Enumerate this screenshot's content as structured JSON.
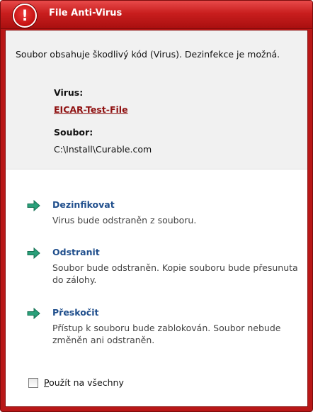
{
  "window": {
    "title": "File Anti-Virus",
    "icon": "alert-exclamation-icon"
  },
  "info": {
    "message": "Soubor obsahuje škodlivý kód (Virus). Dezinfekce je možná.",
    "virus_label": "Virus:",
    "virus_name": "EICAR-Test-File",
    "file_label": "Soubor:",
    "file_path": "C:\\Install\\Curable.com"
  },
  "actions": [
    {
      "title": "Dezinfikovat",
      "description": "Virus bude odstraněn z souboru."
    },
    {
      "title": "Odstranit",
      "description": "Soubor bude odstraněn. Kopie souboru bude přesunuta do zálohy."
    },
    {
      "title": "Přeskočit",
      "description": "Přístup k souboru bude zablokován. Soubor nebude změněn ani odstraněn."
    }
  ],
  "apply_all": {
    "label_mnemonic": "P",
    "label_rest": "oužít na všechny",
    "checked": false
  },
  "colors": {
    "title_bar": "#c91e1e",
    "link": "#8f1111",
    "action_title": "#1f4e8c",
    "arrow": "#2aa07a"
  }
}
